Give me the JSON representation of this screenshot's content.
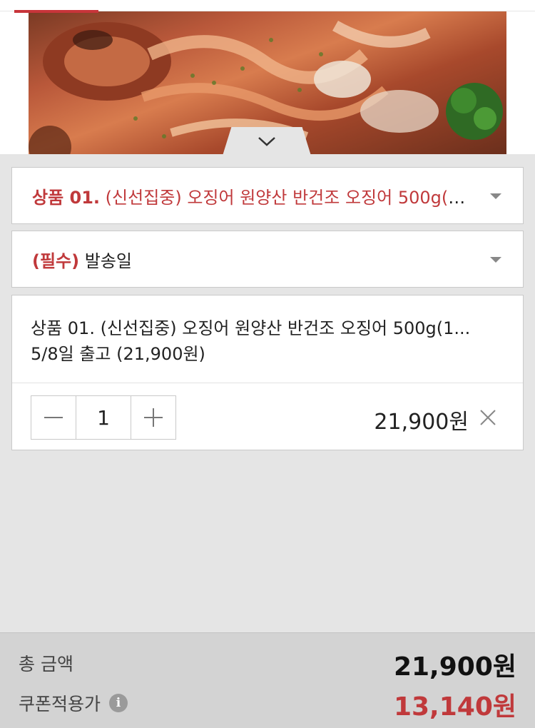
{
  "product": {
    "image_alt": "grilled squid photo"
  },
  "options": {
    "product_select": {
      "prefix": "상품 01.",
      "label": "(신선집중) 오징어 원양산 반건조 오징어 500g(1..."
    },
    "ship_select": {
      "required_tag": "(필수)",
      "label": "발송일"
    }
  },
  "selected_item": {
    "title": "상품 01. (신선집중) 오징어 원양산 반건조 오징어 500g(1...",
    "detail": "5/8일 출고 (21,900원)",
    "quantity": "1",
    "decrease_label": "−",
    "increase_label": "+",
    "price": "21,900원"
  },
  "summary": {
    "total_label": "총 금액",
    "total_value": "21,900원",
    "coupon_label": "쿠폰적용가",
    "coupon_value": "13,140원",
    "info_icon_glyph": "i"
  },
  "colors": {
    "accent_red": "#c0393b",
    "panel_bg": "#e5e5e5",
    "bottom_bar_bg": "#d3d3d3"
  },
  "icons": {
    "collapse": "chevron-down-icon",
    "dropdown": "caret-down-icon",
    "remove": "close-icon",
    "info": "info-icon"
  }
}
